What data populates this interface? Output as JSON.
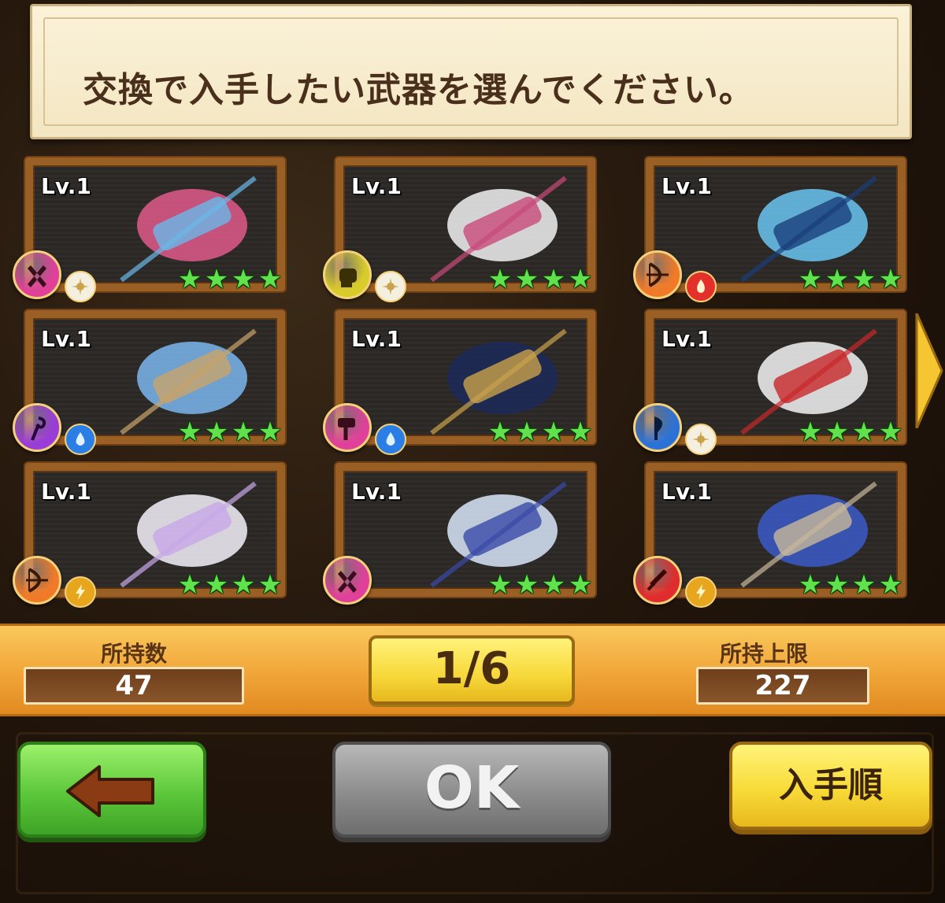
{
  "header": {
    "instruction": "交換で入手したい武器を選んでください。"
  },
  "weapons": [
    {
      "level": "Lv.1",
      "type_icon": "dual-blades-icon",
      "type_color": "#e0409a",
      "element_icon": "light-element-icon",
      "element_color": "#f5efe0",
      "rarity": 4,
      "art": "crossed-swords-weapon"
    },
    {
      "level": "Lv.1",
      "type_icon": "fist-icon",
      "type_color": "#d9cc2a",
      "element_icon": "light-element-icon",
      "element_color": "#f5efe0",
      "rarity": 4,
      "art": "white-card-weapon"
    },
    {
      "level": "Lv.1",
      "type_icon": "bow-icon",
      "type_color": "#f07a28",
      "element_icon": "fire-element-icon",
      "element_color": "#e3302a",
      "rarity": 4,
      "art": "smartphone-weapon"
    },
    {
      "level": "Lv.1",
      "type_icon": "staff-icon",
      "type_color": "#9a3cd8",
      "element_icon": "water-element-icon",
      "element_color": "#2a7ee6",
      "rarity": 4,
      "art": "folding-fan-weapon"
    },
    {
      "level": "Lv.1",
      "type_icon": "hammer-icon",
      "type_color": "#e0409a",
      "element_icon": "water-element-icon",
      "element_color": "#2a7ee6",
      "rarity": 4,
      "art": "scroll-launcher-weapon"
    },
    {
      "level": "Lv.1",
      "type_icon": "axe-icon",
      "type_color": "#2a72d8",
      "element_icon": "light-element-icon",
      "element_color": "#f5efe0",
      "rarity": 4,
      "art": "holly-cane-weapon"
    },
    {
      "level": "Lv.1",
      "type_icon": "bow-icon",
      "type_color": "#f07a28",
      "element_icon": "thunder-element-icon",
      "element_color": "#e8a51e",
      "rarity": 4,
      "art": "bear-camera-weapon"
    },
    {
      "level": "Lv.1",
      "type_icon": "dual-blades-icon",
      "type_color": "#e0409a",
      "element_icon": "none",
      "element_color": "",
      "rarity": 4,
      "art": "book-bow-weapon"
    },
    {
      "level": "Lv.1",
      "type_icon": "sword-icon",
      "type_color": "#e02c2c",
      "element_icon": "thunder-element-icon",
      "element_color": "#e8a51e",
      "rarity": 4,
      "art": "katana-weapon"
    }
  ],
  "counter": {
    "owned_label": "所持数",
    "owned_value": "47",
    "page": "1/6",
    "limit_label": "所持上限",
    "limit_value": "227"
  },
  "buttons": {
    "back_icon": "left-arrow-icon",
    "ok_label": "OK",
    "sort_label": "入手順"
  }
}
